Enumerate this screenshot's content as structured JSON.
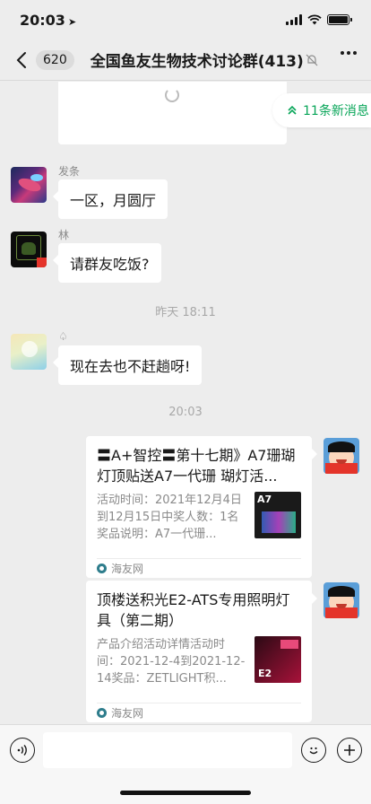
{
  "status": {
    "time": "20:03",
    "location_icon": "location-arrow-icon"
  },
  "nav": {
    "unread_count": "620",
    "title": "全国鱼友生物技术讨论群(413)",
    "mute_icon": "bell-slash-icon"
  },
  "new_messages_pill": {
    "label": "11条新消息"
  },
  "messages": [
    {
      "sender": "发条",
      "text": "一区，月圆厅"
    },
    {
      "sender": "林",
      "text": "请群友吃饭?"
    },
    {
      "sender": "♤",
      "text": "现在去也不赶趟呀!"
    }
  ],
  "time_labels": [
    "昨天 18:11",
    "20:03"
  ],
  "link_cards": [
    {
      "title": "〓A+智控〓第十七期》A7珊瑚灯顶贴送A7一代珊 瑚灯活...",
      "desc": "活动时间：2021年12月4日到12月15日中奖人数：1名奖品说明：A7一代珊...",
      "source": "海友网",
      "thumb_text": "A7"
    },
    {
      "title": "顶楼送积光E2-ATS专用照明灯具（第二期）",
      "desc": "产品介绍活动详情活动时间：2021-12-4到2021-12-14奖品：ZETLIGHT积...",
      "source": "海友网",
      "thumb_text": "E2"
    }
  ],
  "colors": {
    "background": "#ededed",
    "accent_green": "#07a558",
    "bubble_white": "#ffffff"
  }
}
